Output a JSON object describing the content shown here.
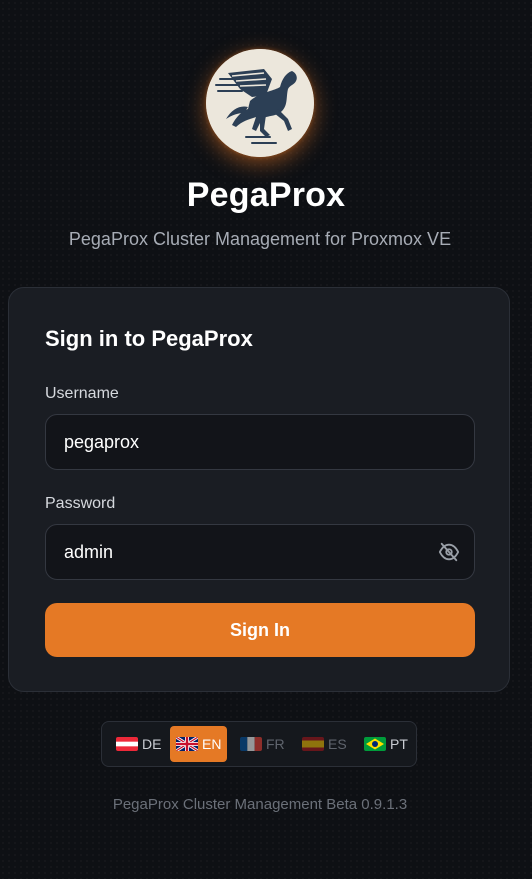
{
  "app": {
    "title": "PegaProx",
    "subtitle": "PegaProx Cluster Management for Proxmox VE"
  },
  "logo": {
    "icon": "pegasus-logo-icon"
  },
  "form": {
    "heading": "Sign in to PegaProx",
    "username_label": "Username",
    "username_value": "pegaprox",
    "password_label": "Password",
    "password_value": "admin",
    "toggle_visibility_icon": "eye-off-icon",
    "submit_label": "Sign In"
  },
  "languages": [
    {
      "code": "DE",
      "flag": "austria-flag",
      "active": false
    },
    {
      "code": "EN",
      "flag": "uk-flag",
      "active": true
    },
    {
      "code": "FR",
      "flag": "france-flag",
      "active": false
    },
    {
      "code": "ES",
      "flag": "spain-flag",
      "active": false
    },
    {
      "code": "PT",
      "flag": "brazil-flag",
      "active": false
    }
  ],
  "footer": {
    "text": "PegaProx Cluster Management Beta 0.9.1.3"
  },
  "colors": {
    "accent": "#e57925",
    "background": "#0e1014",
    "card": "#1a1d23"
  }
}
